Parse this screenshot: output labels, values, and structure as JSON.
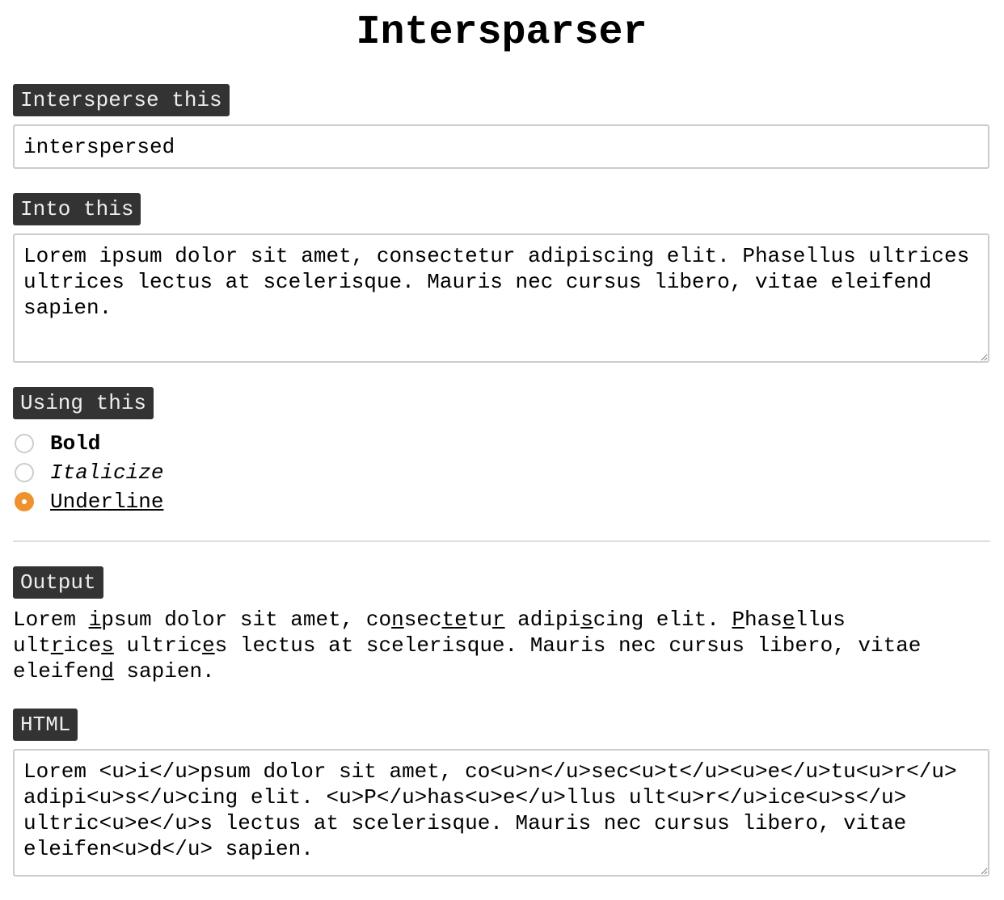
{
  "title": "Intersparser",
  "intersperse": {
    "label": "Intersperse this",
    "value": "interspersed"
  },
  "into": {
    "label": "Into this",
    "value": "Lorem ipsum dolor sit amet, consectetur adipiscing elit. Phasellus ultrices ultrices lectus at scelerisque. Mauris nec cursus libero, vitae eleifend sapien."
  },
  "using": {
    "label": "Using this",
    "options": [
      "Bold",
      "Italicize",
      "Underline"
    ],
    "selected": "Underline"
  },
  "output": {
    "label": "Output",
    "segments": [
      {
        "t": "Lorem "
      },
      {
        "t": "i",
        "u": true
      },
      {
        "t": "psum dolor sit amet, co"
      },
      {
        "t": "n",
        "u": true
      },
      {
        "t": "sec"
      },
      {
        "t": "t",
        "u": true
      },
      {
        "t": "e",
        "u": true
      },
      {
        "t": "tu"
      },
      {
        "t": "r",
        "u": true
      },
      {
        "t": " adipi"
      },
      {
        "t": "s",
        "u": true
      },
      {
        "t": "cing elit. "
      },
      {
        "t": "P",
        "u": true
      },
      {
        "t": "has"
      },
      {
        "t": "e",
        "u": true
      },
      {
        "t": "llus ult"
      },
      {
        "t": "r",
        "u": true
      },
      {
        "t": "ice"
      },
      {
        "t": "s",
        "u": true
      },
      {
        "t": " ultric"
      },
      {
        "t": "e",
        "u": true
      },
      {
        "t": "s lectus at scelerisque. Mauris nec cursus libero, vitae eleifen"
      },
      {
        "t": "d",
        "u": true
      },
      {
        "t": " sapien."
      }
    ]
  },
  "html": {
    "label": "HTML",
    "value": "Lorem <u>i</u>psum dolor sit amet, co<u>n</u>sec<u>t</u><u>e</u>tu<u>r</u> adipi<u>s</u>cing elit. <u>P</u>has<u>e</u>llus ult<u>r</u>ice<u>s</u> ultric<u>e</u>s lectus at scelerisque. Mauris nec cursus libero, vitae eleifen<u>d</u> sapien."
  },
  "colors": {
    "label_bg": "#333333",
    "accent": "#ee922f"
  }
}
